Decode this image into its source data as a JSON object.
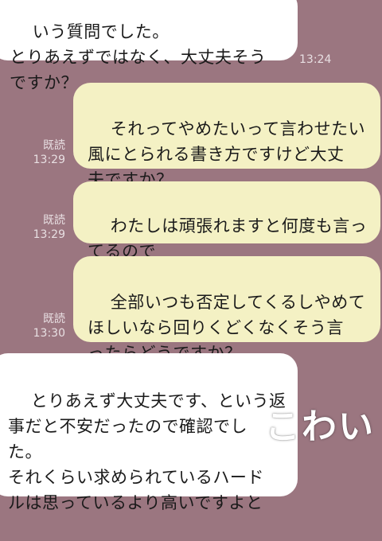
{
  "messages": [
    {
      "side": "in",
      "lines": "いう質問でした。\nとりあえずではなく、大丈夫そう\nですか？",
      "time": "13:24"
    },
    {
      "side": "out",
      "lines": "それってやめたいって言わせたい\n風にとられる書き方ですけど大丈\n夫ですか？",
      "read": "既読",
      "time": "13:29"
    },
    {
      "side": "out",
      "lines": "わたしは頑張れますと何度も言っ\nてるので",
      "read": "既読",
      "time": "13:29"
    },
    {
      "side": "out",
      "lines": "全部いつも否定してくるしやめて\nほしいなら回りくどくなくそう言\nったらどうですか？",
      "read": "既読",
      "time": "13:30"
    },
    {
      "side": "in",
      "lines": "とりあえず大丈夫です、という返\n事だと不安だったので確認でし\nた。\nそれくらい求められているハード\nルは思っているより高いですよと"
    }
  ],
  "overlay_text": "こわい",
  "colors": {
    "background": "#9b7680",
    "incoming_bubble": "#ffffff",
    "outgoing_bubble": "#f4f1c4",
    "meta_text": "#e8dfe2"
  }
}
